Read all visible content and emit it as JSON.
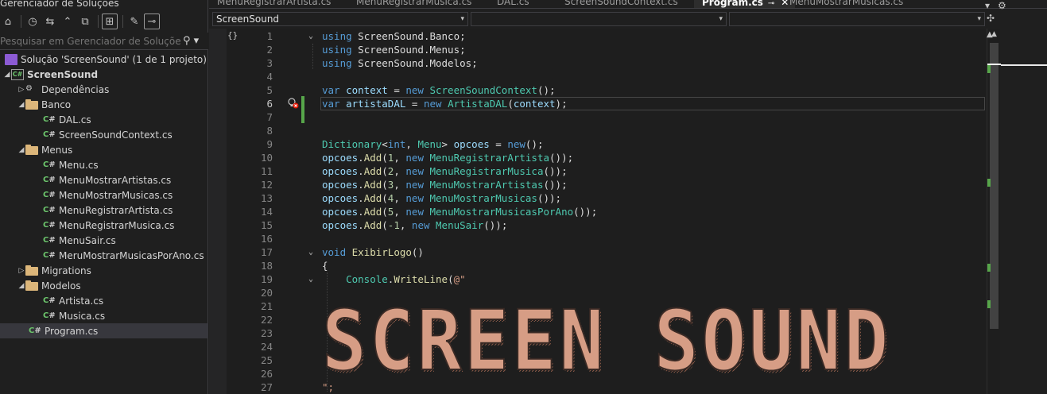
{
  "explorer": {
    "title": "Gerenciador de Soluções",
    "search_placeholder": "Pesquisar em Gerenciador de Soluções (Ctr",
    "toolbar_icons": [
      "home-icon",
      "history-icon",
      "sync-icon",
      "collapse-all-icon",
      "show-all-files-icon",
      "switch-view-icon",
      "properties-icon",
      "preview-icon"
    ],
    "items": [
      {
        "label": "Solução 'ScreenSound' (1 de 1 projeto)",
        "type": "solution",
        "level": 0,
        "arrow": ""
      },
      {
        "label": "ScreenSound",
        "type": "project",
        "level": 0,
        "arrow": "expanded",
        "bold": true
      },
      {
        "label": "Dependências",
        "type": "dependencies",
        "level": 1,
        "arrow": "collapsed"
      },
      {
        "label": "Banco",
        "type": "folder",
        "level": 1,
        "arrow": "expanded"
      },
      {
        "label": "DAL.cs",
        "type": "cs",
        "level": 2,
        "arrow": ""
      },
      {
        "label": "ScreenSoundContext.cs",
        "type": "cs",
        "level": 2,
        "arrow": ""
      },
      {
        "label": "Menus",
        "type": "folder",
        "level": 1,
        "arrow": "expanded"
      },
      {
        "label": "Menu.cs",
        "type": "cs",
        "level": 2,
        "arrow": ""
      },
      {
        "label": "MenuMostrarArtistas.cs",
        "type": "cs",
        "level": 2,
        "arrow": ""
      },
      {
        "label": "MenuMostrarMusicas.cs",
        "type": "cs",
        "level": 2,
        "arrow": ""
      },
      {
        "label": "MenuRegistrarArtista.cs",
        "type": "cs",
        "level": 2,
        "arrow": ""
      },
      {
        "label": "MenuRegistrarMusica.cs",
        "type": "cs",
        "level": 2,
        "arrow": ""
      },
      {
        "label": "MenuSair.cs",
        "type": "cs",
        "level": 2,
        "arrow": ""
      },
      {
        "label": "MeruMostrarMusicasPorAno.cs",
        "type": "cs",
        "level": 2,
        "arrow": ""
      },
      {
        "label": "Migrations",
        "type": "folder",
        "level": 1,
        "arrow": "collapsed"
      },
      {
        "label": "Modelos",
        "type": "folder",
        "level": 1,
        "arrow": "expanded"
      },
      {
        "label": "Artista.cs",
        "type": "cs",
        "level": 2,
        "arrow": ""
      },
      {
        "label": "Musica.cs",
        "type": "cs",
        "level": 2,
        "arrow": ""
      },
      {
        "label": "Program.cs",
        "type": "cs",
        "level": 1,
        "arrow": "",
        "selected": true
      }
    ]
  },
  "tabs": [
    {
      "label": "MenuRegistrarArtista.cs",
      "active": false
    },
    {
      "label": "MenuRegistrarMusica.cs",
      "active": false
    },
    {
      "label": "DAL.cs",
      "active": false
    },
    {
      "label": "ScreenSoundContext.cs",
      "active": false
    },
    {
      "label": "Program.cs",
      "active": true,
      "pin": "⊸",
      "close": "✕"
    },
    {
      "label": "MenuMostrarMusicas.cs",
      "active": false
    }
  ],
  "navbar": {
    "project": "ScreenSound",
    "type": "",
    "member": ""
  },
  "editor": {
    "current_line": 6,
    "lines": [
      {
        "n": 1,
        "fold": "v",
        "tokens": [
          [
            "kw",
            "using"
          ],
          [
            "nm",
            " ScreenSound.Banco;"
          ]
        ]
      },
      {
        "n": 2,
        "tokens": [
          [
            "kw",
            "using"
          ],
          [
            "nm",
            " ScreenSound.Menus;"
          ]
        ]
      },
      {
        "n": 3,
        "tokens": [
          [
            "kw",
            "using"
          ],
          [
            "nm",
            " ScreenSound.Modelos;"
          ]
        ]
      },
      {
        "n": 4,
        "tokens": []
      },
      {
        "n": 5,
        "tokens": [
          [
            "kw",
            "var"
          ],
          [
            "pu",
            " "
          ],
          [
            "lv",
            "context"
          ],
          [
            "pu",
            " = "
          ],
          [
            "kw",
            "new"
          ],
          [
            "pu",
            " "
          ],
          [
            "ty",
            "ScreenSoundContext"
          ],
          [
            "pu",
            "();"
          ]
        ]
      },
      {
        "n": 6,
        "tokens": [
          [
            "kw",
            "var"
          ],
          [
            "pu",
            " "
          ],
          [
            "lv",
            "artistaDAL"
          ],
          [
            "pu",
            " = "
          ],
          [
            "kw",
            "new"
          ],
          [
            "pu",
            " "
          ],
          [
            "ty",
            "ArtistaDAL"
          ],
          [
            "pu",
            "("
          ],
          [
            "lv",
            "context"
          ],
          [
            "pu",
            ");"
          ]
        ]
      },
      {
        "n": 7,
        "tokens": []
      },
      {
        "n": 8,
        "tokens": []
      },
      {
        "n": 9,
        "tokens": [
          [
            "ty",
            "Dictionary"
          ],
          [
            "pu",
            "<"
          ],
          [
            "kw",
            "int"
          ],
          [
            "pu",
            ", "
          ],
          [
            "ty",
            "Menu"
          ],
          [
            "pu",
            "> "
          ],
          [
            "lv",
            "opcoes"
          ],
          [
            "pu",
            " = "
          ],
          [
            "kw",
            "new"
          ],
          [
            "pu",
            "();"
          ]
        ]
      },
      {
        "n": 10,
        "tokens": [
          [
            "lv",
            "opcoes"
          ],
          [
            "pu",
            "."
          ],
          [
            "mt",
            "Add"
          ],
          [
            "pu",
            "("
          ],
          [
            "num",
            "1"
          ],
          [
            "pu",
            ", "
          ],
          [
            "kw",
            "new"
          ],
          [
            "pu",
            " "
          ],
          [
            "ty",
            "MenuRegistrarArtista"
          ],
          [
            "pu",
            "());"
          ]
        ]
      },
      {
        "n": 11,
        "tokens": [
          [
            "lv",
            "opcoes"
          ],
          [
            "pu",
            "."
          ],
          [
            "mt",
            "Add"
          ],
          [
            "pu",
            "("
          ],
          [
            "num",
            "2"
          ],
          [
            "pu",
            ", "
          ],
          [
            "kw",
            "new"
          ],
          [
            "pu",
            " "
          ],
          [
            "ty",
            "MenuRegistrarMusica"
          ],
          [
            "pu",
            "());"
          ]
        ]
      },
      {
        "n": 12,
        "tokens": [
          [
            "lv",
            "opcoes"
          ],
          [
            "pu",
            "."
          ],
          [
            "mt",
            "Add"
          ],
          [
            "pu",
            "("
          ],
          [
            "num",
            "3"
          ],
          [
            "pu",
            ", "
          ],
          [
            "kw",
            "new"
          ],
          [
            "pu",
            " "
          ],
          [
            "ty",
            "MenuMostrarArtistas"
          ],
          [
            "pu",
            "());"
          ]
        ]
      },
      {
        "n": 13,
        "tokens": [
          [
            "lv",
            "opcoes"
          ],
          [
            "pu",
            "."
          ],
          [
            "mt",
            "Add"
          ],
          [
            "pu",
            "("
          ],
          [
            "num",
            "4"
          ],
          [
            "pu",
            ", "
          ],
          [
            "kw",
            "new"
          ],
          [
            "pu",
            " "
          ],
          [
            "ty",
            "MenuMostrarMusicas"
          ],
          [
            "pu",
            "());"
          ]
        ]
      },
      {
        "n": 14,
        "tokens": [
          [
            "lv",
            "opcoes"
          ],
          [
            "pu",
            "."
          ],
          [
            "mt",
            "Add"
          ],
          [
            "pu",
            "("
          ],
          [
            "num",
            "5"
          ],
          [
            "pu",
            ", "
          ],
          [
            "kw",
            "new"
          ],
          [
            "pu",
            " "
          ],
          [
            "ty",
            "MenuMostrarMusicasPorAno"
          ],
          [
            "pu",
            "());"
          ]
        ]
      },
      {
        "n": 15,
        "tokens": [
          [
            "lv",
            "opcoes"
          ],
          [
            "pu",
            "."
          ],
          [
            "mt",
            "Add"
          ],
          [
            "pu",
            "("
          ],
          [
            "num",
            "-1"
          ],
          [
            "pu",
            ", "
          ],
          [
            "kw",
            "new"
          ],
          [
            "pu",
            " "
          ],
          [
            "ty",
            "MenuSair"
          ],
          [
            "pu",
            "());"
          ]
        ]
      },
      {
        "n": 16,
        "tokens": []
      },
      {
        "n": 17,
        "fold": "v",
        "tokens": [
          [
            "kw",
            "void"
          ],
          [
            "pu",
            " "
          ],
          [
            "mt",
            "ExibirLogo"
          ],
          [
            "pu",
            "()"
          ]
        ]
      },
      {
        "n": 18,
        "tokens": [
          [
            "pu",
            "{"
          ]
        ]
      },
      {
        "n": 19,
        "fold": "v",
        "tokens": [
          [
            "pu",
            "    "
          ],
          [
            "ty",
            "Console"
          ],
          [
            "pu",
            "."
          ],
          [
            "mt",
            "WriteLine"
          ],
          [
            "pu",
            "("
          ],
          [
            "str",
            "@\""
          ]
        ]
      },
      {
        "n": 20,
        "tokens": []
      },
      {
        "n": 21,
        "tokens": []
      },
      {
        "n": 22,
        "tokens": []
      },
      {
        "n": 23,
        "tokens": []
      },
      {
        "n": 24,
        "tokens": []
      },
      {
        "n": 25,
        "tokens": []
      },
      {
        "n": 26,
        "tokens": []
      },
      {
        "n": 27,
        "tokens": [
          [
            "str",
            "\";"
          ]
        ]
      }
    ],
    "art_text": "SCREEN SOUND"
  },
  "colors": {
    "keyword": "#569cd6",
    "type": "#4ec9b0",
    "local": "#9cdcfe",
    "method": "#dcdcaa",
    "number": "#b5cea8",
    "string": "#d69d85",
    "changed_bar": "#57a64a"
  }
}
